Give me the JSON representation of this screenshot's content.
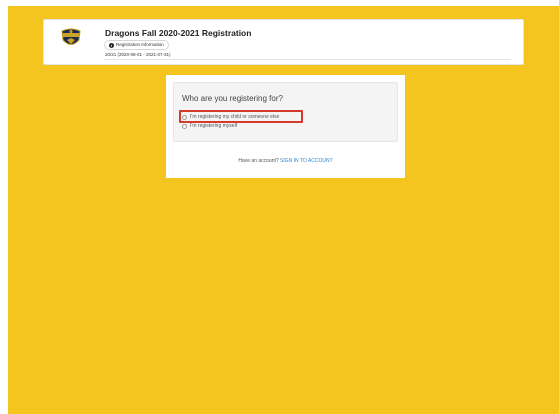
{
  "header": {
    "title": "Dragons Fall 2020-2021 Registration",
    "info_label": "Registration Information",
    "info_icon": "info-icon",
    "season": "20/21 (2020-08-01 - 2021-07-31)",
    "logo_icon": "club-crest-logo"
  },
  "registration": {
    "question": "Who are you registering for?",
    "options": [
      {
        "label": "I'm registering my child or someone else",
        "selected": false,
        "highlighted": true
      },
      {
        "label": "I'm registering myself",
        "selected": false,
        "highlighted": false
      }
    ]
  },
  "account": {
    "prompt": "Have an account?",
    "link_label": "SIGN IN TO ACCOUNT"
  },
  "colors": {
    "background": "#f4c41f",
    "link": "#2e86d4",
    "highlight": "#d63a2b"
  }
}
